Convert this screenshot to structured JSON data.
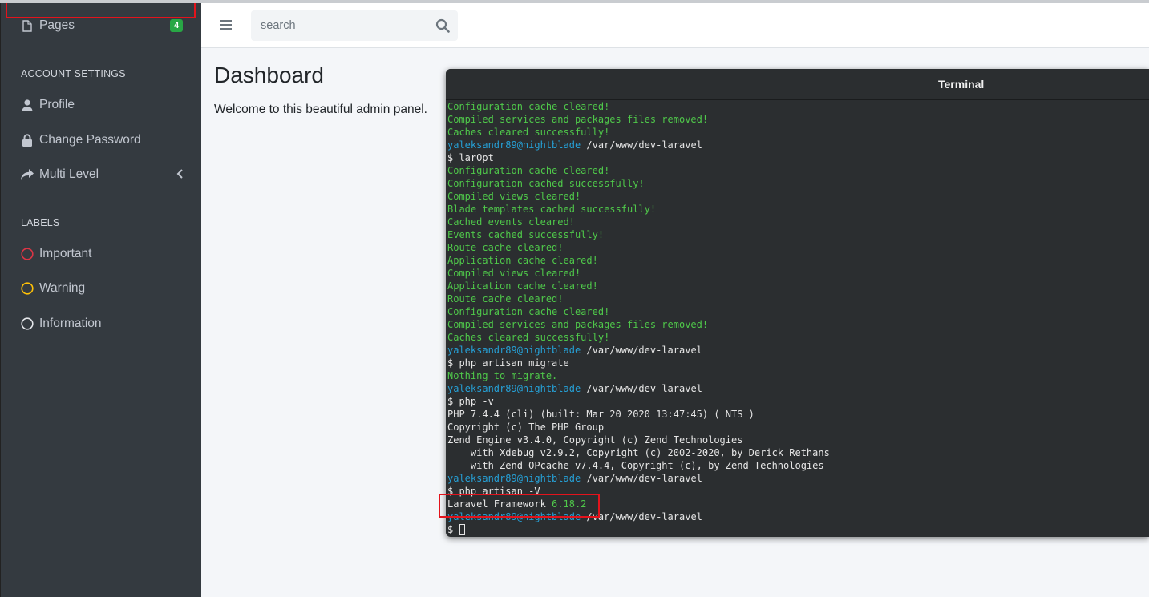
{
  "sidebar": {
    "pages_label": "Pages",
    "pages_badge": "4",
    "account_header": "ACCOUNT SETTINGS",
    "profile_label": "Profile",
    "change_password_label": "Change Password",
    "multi_level_label": "Multi Level",
    "labels_header": "LABELS",
    "important_label": "Important",
    "warning_label": "Warning",
    "information_label": "Information"
  },
  "topbar": {
    "search_placeholder": "search"
  },
  "main": {
    "title": "Dashboard",
    "welcome": "Welcome to this beautiful admin panel."
  },
  "terminal": {
    "title": "Terminal",
    "lines": [
      [
        {
          "t": "Configuration cache cleared!",
          "c": "g"
        }
      ],
      [
        {
          "t": "Compiled services and packages files removed!",
          "c": "g"
        }
      ],
      [
        {
          "t": "Caches cleared successfully!",
          "c": "g"
        }
      ],
      [
        {
          "t": "yaleksandr89@nightblade",
          "c": "c"
        },
        {
          "t": " /var/www/dev-laravel",
          "c": "w"
        }
      ],
      [
        {
          "t": "$ larOpt",
          "c": "w"
        }
      ],
      [
        {
          "t": "Configuration cache cleared!",
          "c": "g"
        }
      ],
      [
        {
          "t": "Configuration cached successfully!",
          "c": "g"
        }
      ],
      [
        {
          "t": "Compiled views cleared!",
          "c": "g"
        }
      ],
      [
        {
          "t": "Blade templates cached successfully!",
          "c": "g"
        }
      ],
      [
        {
          "t": "Cached events cleared!",
          "c": "g"
        }
      ],
      [
        {
          "t": "Events cached successfully!",
          "c": "g"
        }
      ],
      [
        {
          "t": "Route cache cleared!",
          "c": "g"
        }
      ],
      [
        {
          "t": "Application cache cleared!",
          "c": "g"
        }
      ],
      [
        {
          "t": "Compiled views cleared!",
          "c": "g"
        }
      ],
      [
        {
          "t": "Application cache cleared!",
          "c": "g"
        }
      ],
      [
        {
          "t": "Route cache cleared!",
          "c": "g"
        }
      ],
      [
        {
          "t": "Configuration cache cleared!",
          "c": "g"
        }
      ],
      [
        {
          "t": "Compiled services and packages files removed!",
          "c": "g"
        }
      ],
      [
        {
          "t": "Caches cleared successfully!",
          "c": "g"
        }
      ],
      [
        {
          "t": "yaleksandr89@nightblade",
          "c": "c"
        },
        {
          "t": " /var/www/dev-laravel",
          "c": "w"
        }
      ],
      [
        {
          "t": "$ php artisan migrate",
          "c": "w"
        }
      ],
      [
        {
          "t": "Nothing to migrate.",
          "c": "g"
        }
      ],
      [
        {
          "t": "yaleksandr89@nightblade",
          "c": "c"
        },
        {
          "t": " /var/www/dev-laravel",
          "c": "w"
        }
      ],
      [
        {
          "t": "$ php -v",
          "c": "w"
        }
      ],
      [
        {
          "t": "PHP 7.4.4 (cli) (built: Mar 20 2020 13:47:45) ( NTS )",
          "c": "w"
        }
      ],
      [
        {
          "t": "Copyright (c) The PHP Group",
          "c": "w"
        }
      ],
      [
        {
          "t": "Zend Engine v3.4.0, Copyright (c) Zend Technologies",
          "c": "w"
        }
      ],
      [
        {
          "t": "    with Xdebug v2.9.2, Copyright (c) 2002-2020, by Derick Rethans",
          "c": "w"
        }
      ],
      [
        {
          "t": "    with Zend OPcache v7.4.4, Copyright (c), by Zend Technologies",
          "c": "w"
        }
      ],
      [
        {
          "t": "yaleksandr89@nightblade",
          "c": "c"
        },
        {
          "t": " /var/www/dev-laravel",
          "c": "w"
        }
      ],
      [
        {
          "t": "$ php artisan -V",
          "c": "w"
        }
      ],
      [
        {
          "t": "Laravel Framework ",
          "c": "w"
        },
        {
          "t": "6.18.2",
          "c": "g"
        }
      ],
      [
        {
          "t": "yaleksandr89@nightblade",
          "c": "c"
        },
        {
          "t": " /var/www/dev-laravel",
          "c": "w"
        }
      ],
      [
        {
          "t": "$ ",
          "c": "w"
        }
      ]
    ]
  },
  "colors": {
    "sidebar_bg": "#343a40",
    "badge_green": "#28a745",
    "important_red": "#dc3545",
    "warning_yellow": "#ffc107",
    "terminal_green": "#4fc84a",
    "terminal_cyan": "#26a0d6",
    "highlight_red": "#e3131c"
  },
  "icons": {
    "pages": "file-icon",
    "profile": "user-icon",
    "change_password": "lock-icon",
    "multi_level": "share-icon",
    "multi_level_toggle": "chevron-left-icon",
    "important": "circle-outline-icon",
    "warning": "circle-outline-icon",
    "information": "circle-outline-icon",
    "menu": "hamburger-icon",
    "search": "search-icon"
  }
}
